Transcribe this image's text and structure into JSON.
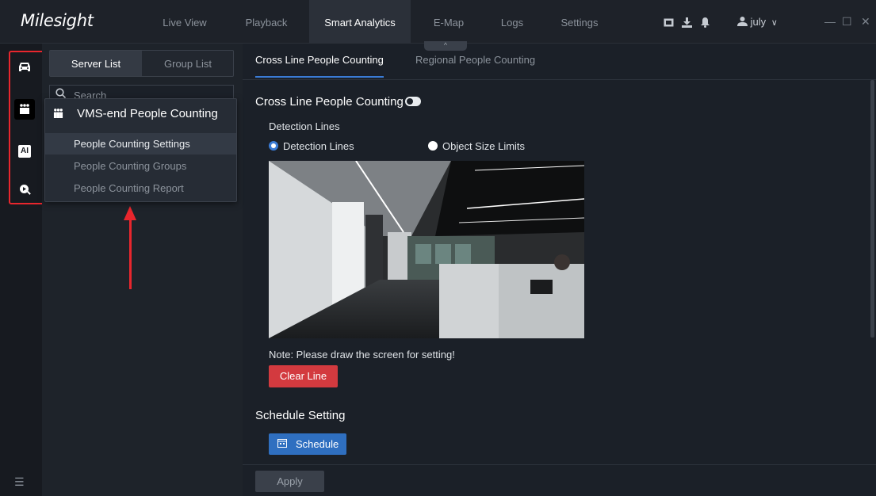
{
  "app": {
    "logo": "Milesight",
    "nav": [
      "Live View",
      "Playback",
      "Smart Analytics",
      "E-Map",
      "Logs",
      "Settings"
    ],
    "active_nav": "Smart Analytics",
    "nav_caret": "^",
    "user": "july",
    "user_caret": "∨",
    "window_controls": [
      "—",
      "☐",
      "✕"
    ]
  },
  "sidebar": {
    "icons": [
      "car-icon",
      "people-icon",
      "ai-icon",
      "search-report-icon"
    ],
    "ai_label": "AI",
    "menu_icon": "☰"
  },
  "panel": {
    "tabs": [
      "Server List",
      "Group List"
    ],
    "search_placeholder": "Search"
  },
  "popup": {
    "title": "VMS-end People Counting",
    "items": [
      "People Counting Settings",
      "People Counting Groups",
      "People Counting Report"
    ]
  },
  "main": {
    "tabs": [
      "Cross Line People Counting",
      "Regional People Counting"
    ],
    "section_title": "Cross Line People Counting",
    "detection_label": "Detection Lines",
    "radio_options": [
      "Detection Lines",
      "Object Size Limits"
    ],
    "note": "Note: Please draw the screen for setting!",
    "clear_line": "Clear Line",
    "schedule_title": "Schedule Setting",
    "schedule_button": "Schedule",
    "apply_button": "Apply"
  },
  "colors": {
    "accent": "#3a7bd5",
    "danger": "#d33a3f",
    "highlight_box": "#e8262d"
  }
}
